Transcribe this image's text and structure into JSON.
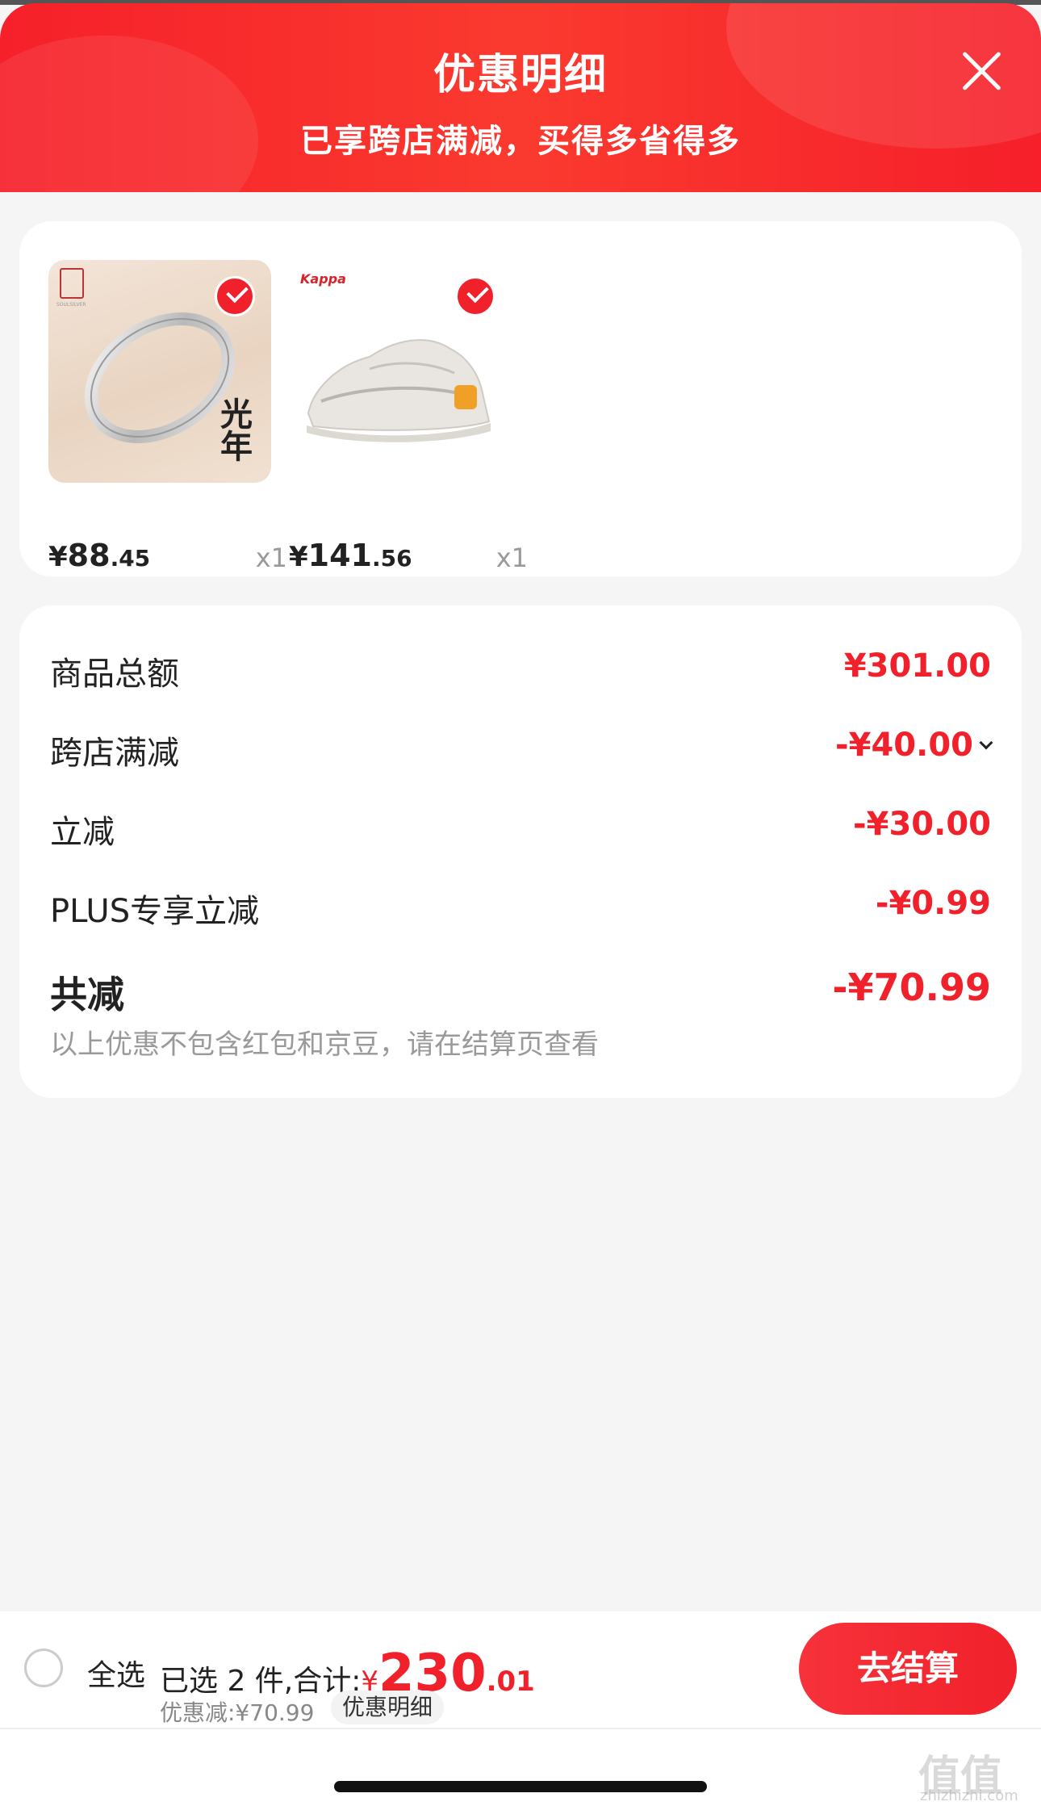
{
  "header": {
    "title": "优惠明细",
    "subtitle": "已享跨店满减，买得多省得多",
    "close_icon": "close-icon"
  },
  "products": [
    {
      "price_symbol": "¥",
      "price_int": "88",
      "price_dec": ".45",
      "qty": "x1",
      "checked": true,
      "image": "silver-ring-product-image",
      "image_text": "光年"
    },
    {
      "price_symbol": "¥",
      "price_int": "141",
      "price_dec": ".56",
      "qty": "x1",
      "checked": true,
      "image": "kappa-sneaker-product-image",
      "brand": "Kappa"
    }
  ],
  "summary": {
    "rows": [
      {
        "label": "商品总额",
        "value": "¥301.00"
      },
      {
        "label": "跨店满减",
        "value": "-¥40.00"
      },
      {
        "label": "立减",
        "value": "-¥30.00"
      },
      {
        "label": "PLUS专享立减",
        "value": "-¥0.99"
      }
    ],
    "total_label": "共减",
    "total_value": "-¥70.99",
    "note": "以上优惠不包含红包和京豆，请在结算页查看"
  },
  "bottom_bar": {
    "select_all": "全选",
    "selected_prefix": "已选 2 件,合计:",
    "total_symbol": "¥",
    "total_int": "230",
    "total_dec": ".01",
    "discount": "优惠减:¥70.99",
    "detail_chip": "优惠明细",
    "checkout": "去结算"
  },
  "watermark": {
    "text": "值值值",
    "sub": "zhizhizhi.com"
  },
  "colors": {
    "accent": "#f0212b",
    "header_red": "#f6202a",
    "background": "#f5f5f5"
  }
}
